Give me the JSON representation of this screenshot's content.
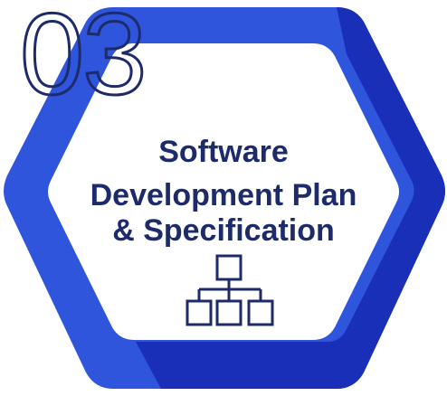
{
  "badge": {
    "step_number": "03",
    "title_lines": [
      "Software",
      "Development Plan",
      "& Specification"
    ],
    "icon": "org-chart-icon",
    "colors": {
      "hexagon_outer": "#2f55dc",
      "hexagon_shadow": "#1a2fb8",
      "hexagon_inner": "#ffffff",
      "text": "#1d2b6b",
      "icon_stroke": "#1d2b6b"
    }
  }
}
